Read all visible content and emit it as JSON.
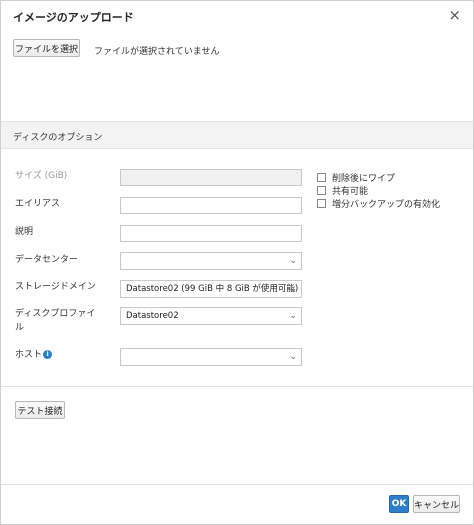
{
  "dialog": {
    "title": "イメージのアップロード",
    "close_glyph": "×"
  },
  "file": {
    "choose_button": "ファイルを選択",
    "status": "ファイルが選択されていません"
  },
  "options": {
    "section_title": "ディスクのオプション",
    "labels": {
      "size": "サイズ (GiB)",
      "alias": "エイリアス",
      "description": "説明",
      "datacenter": "データセンター",
      "storage_domain": "ストレージドメイン",
      "disk_profile": "ディスクプロファイル",
      "host": "ホスト"
    },
    "values": {
      "size": "",
      "alias": "",
      "description": "",
      "datacenter": "",
      "storage_domain": "Datastore02 (99 GiB 中 8 GiB が使用可能)",
      "disk_profile": "Datastore02",
      "host": ""
    },
    "checkboxes": [
      {
        "label": "削除後にワイプ",
        "checked": false
      },
      {
        "label": "共有可能",
        "checked": false
      },
      {
        "label": "増分バックアップの有効化",
        "checked": false
      }
    ]
  },
  "actions": {
    "test_connection": "テスト接続",
    "ok": "OK",
    "cancel": "キャンセル"
  },
  "icons": {
    "host_info": "info-icon",
    "select_arrow": "chevron-down-icon"
  },
  "colors": {
    "primary": "#2f7fc8",
    "info": "#2a7ec9"
  }
}
